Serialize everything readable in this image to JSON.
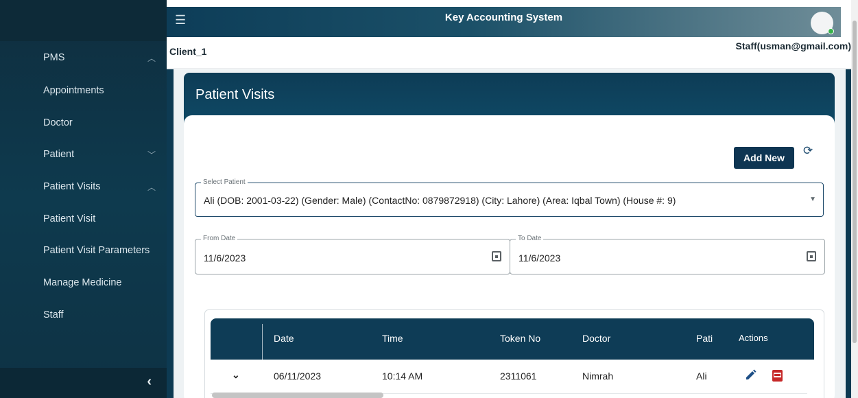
{
  "app": {
    "title": "Key Accounting System"
  },
  "subheader": {
    "client": "Client_1",
    "user": "Staff(usman@gmail.com)"
  },
  "sidebar": {
    "items": [
      {
        "label": "PMS",
        "chevron": "chevron-up-icon"
      },
      {
        "label": "Appointments"
      },
      {
        "label": "Doctor"
      },
      {
        "label": "Patient",
        "chevron": "chevron-down-icon"
      },
      {
        "label": "Patient Visits",
        "chevron": "chevron-up-icon"
      },
      {
        "label": "Patient Visit"
      },
      {
        "label": "Patient Visit Parameters"
      },
      {
        "label": "Manage Medicine"
      },
      {
        "label": "Staff"
      }
    ],
    "collapse_glyph": "‹"
  },
  "page": {
    "title": "Patient Visits",
    "add_new_label": "Add New",
    "select_patient": {
      "label": "Select Patient",
      "value": "Ali (DOB: 2001-03-22) (Gender: Male) (ContactNo: 0879872918) (City: Lahore) (Area: Iqbal Town) (House #: 9)"
    },
    "from_date": {
      "label": "From Date",
      "value": "11/6/2023"
    },
    "to_date": {
      "label": "To Date",
      "value": "11/6/2023"
    }
  },
  "table": {
    "headers": {
      "date": "Date",
      "time": "Time",
      "token": "Token No",
      "doctor": "Doctor",
      "patient": "Pati",
      "actions": "Actions"
    },
    "rows": [
      {
        "date": "06/11/2023",
        "time": "10:14 AM",
        "token": "2311061",
        "doctor": "Nimrah",
        "patient": "Ali"
      }
    ]
  },
  "colors": {
    "sidebar": "#0f2e3f",
    "header": "#0d3c56",
    "accent": "#0e3552",
    "pdf": "#c62828"
  }
}
